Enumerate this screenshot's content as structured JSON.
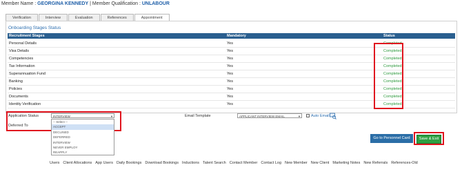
{
  "member": {
    "name_label": "Member Name : ",
    "name": "GEORGINA KENNEDY",
    "sep": " | Member Qualification : ",
    "qualification": "UNLABOUR"
  },
  "tabs": [
    {
      "label": "Verification"
    },
    {
      "label": "Interview"
    },
    {
      "label": "Evaluation"
    },
    {
      "label": "References"
    },
    {
      "label": "Appointment"
    }
  ],
  "panel_title": "Onboarding Stages Status",
  "table": {
    "headers": [
      "Recruitment Stages",
      "Mandatory",
      "Status"
    ],
    "rows": [
      {
        "stage": "Personal Details",
        "mandatory": "Yes",
        "status": "Completed"
      },
      {
        "stage": "Visa Details",
        "mandatory": "Yes",
        "status": "Completed"
      },
      {
        "stage": "Competencies",
        "mandatory": "Yes",
        "status": "Completed"
      },
      {
        "stage": "Tax Information",
        "mandatory": "Yes",
        "status": "Completed"
      },
      {
        "stage": "Superannuation Fund",
        "mandatory": "Yes",
        "status": "Completed"
      },
      {
        "stage": "Banking",
        "mandatory": "Yes",
        "status": "Completed"
      },
      {
        "stage": "Policies",
        "mandatory": "Yes",
        "status": "Completed"
      },
      {
        "stage": "Documents",
        "mandatory": "Yes",
        "status": "Completed"
      },
      {
        "stage": "Identity Verification",
        "mandatory": "Yes",
        "status": "Completed"
      }
    ]
  },
  "form": {
    "application_status_label": "Application Status",
    "application_status_value": "INTERVIEW",
    "deferred_to_label": "Deferred To",
    "dropdown_options": [
      "-- Select --",
      "ACCEPT",
      "DECLINED",
      "DEFERRED",
      "INTERVIEW",
      "NEVER EMPLOY",
      "REAPPLY"
    ],
    "email_template_label": "Email Template",
    "email_template_value": "APPLICANT INTERVIEW EMAIL",
    "auto_email_label": "Auto Email"
  },
  "buttons": {
    "personnel_card": "Go to Personnel Card",
    "save_exit": "Save & Exit"
  },
  "footer_links": [
    "Users",
    "Client Allocations",
    "App Users",
    "Daily Bookings",
    "Download Bookings",
    "Inductions",
    "Talent Search",
    "Contact Member",
    "Contact Log",
    "New Member",
    "New Client",
    "Marketing Notes",
    "New Referrals",
    "References-Old"
  ],
  "colors": {
    "header_bg": "#2a5f8f",
    "completed": "#2e9a3e",
    "highlight": "#e0141e",
    "link": "#1f5fa8"
  }
}
